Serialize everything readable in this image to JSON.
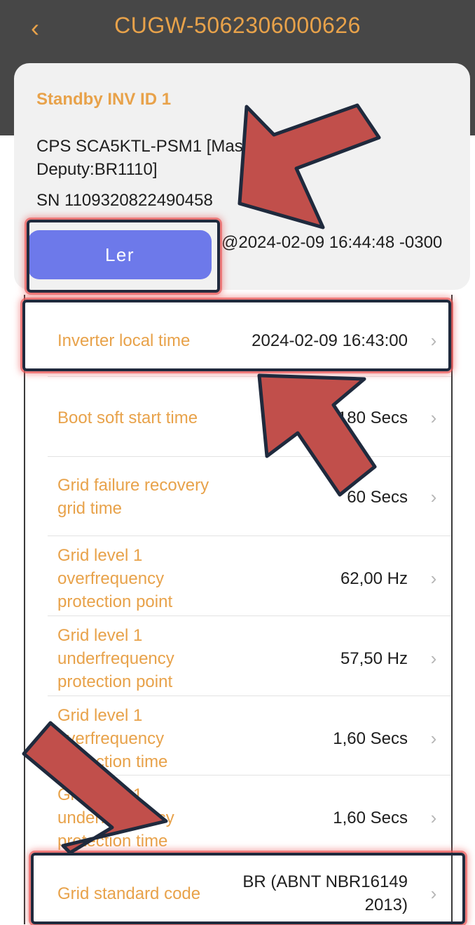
{
  "header": {
    "back_icon": "chevron-left-icon",
    "title": "CUGW-5062306000626"
  },
  "card": {
    "heading": "Standby INV ID 1",
    "model": "CPS SCA5KTL-PSM1 [Master:BR1110; Deputy:BR1110]",
    "sn": "SN 1109320822490458",
    "read_button": "Ler",
    "timestamp": "@2024-02-09 16:44:48 -0300"
  },
  "params": [
    {
      "label": "Inverter local time",
      "value": "2024-02-09 16:43:00"
    },
    {
      "label": "Boot soft start time",
      "value": "180 Secs"
    },
    {
      "label": "Grid failure recovery grid time",
      "value": "60 Secs"
    },
    {
      "label": "Grid level 1 overfrequency protection point",
      "value": "62,00 Hz"
    },
    {
      "label": "Grid level 1 underfrequency protection point",
      "value": "57,50 Hz"
    },
    {
      "label": "Grid level 1 overfrequency protection time",
      "value": "1,60 Secs"
    },
    {
      "label": "Grid level 1 underfrequency protection time",
      "value": "1,60 Secs"
    },
    {
      "label": "Grid standard code",
      "value": "BR (ABNT NBR16149 2013)"
    }
  ],
  "colors": {
    "accent": "#e8a24a",
    "topbar": "#474747",
    "button": "#6d79ea",
    "arrow": "#c14f4b",
    "highlight_border": "#1f2a3d"
  }
}
